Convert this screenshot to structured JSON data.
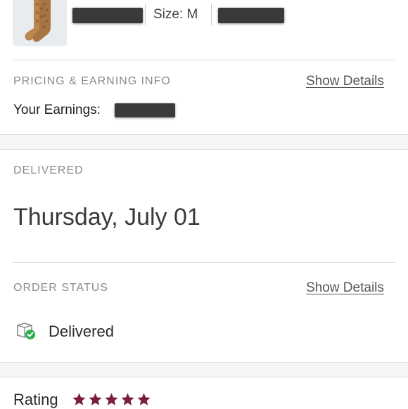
{
  "product": {
    "size_label": "Size: M"
  },
  "pricing": {
    "section_label": "PRICING & EARNING INFO",
    "show_details_label": "Show Details",
    "earnings_label": "Your Earnings:"
  },
  "delivery": {
    "section_label": "DELIVERED",
    "date": "Thursday, July 01"
  },
  "order_status": {
    "section_label": "ORDER STATUS",
    "show_details_label": "Show Details",
    "status_icon": "package-delivered-icon",
    "status": "Delivered"
  },
  "rating": {
    "label": "Rating",
    "stars": 5,
    "max_stars": 5,
    "star_color": "#7b1e35"
  },
  "colors": {
    "success_green": "#2fae52",
    "star": "#7b1e35"
  }
}
